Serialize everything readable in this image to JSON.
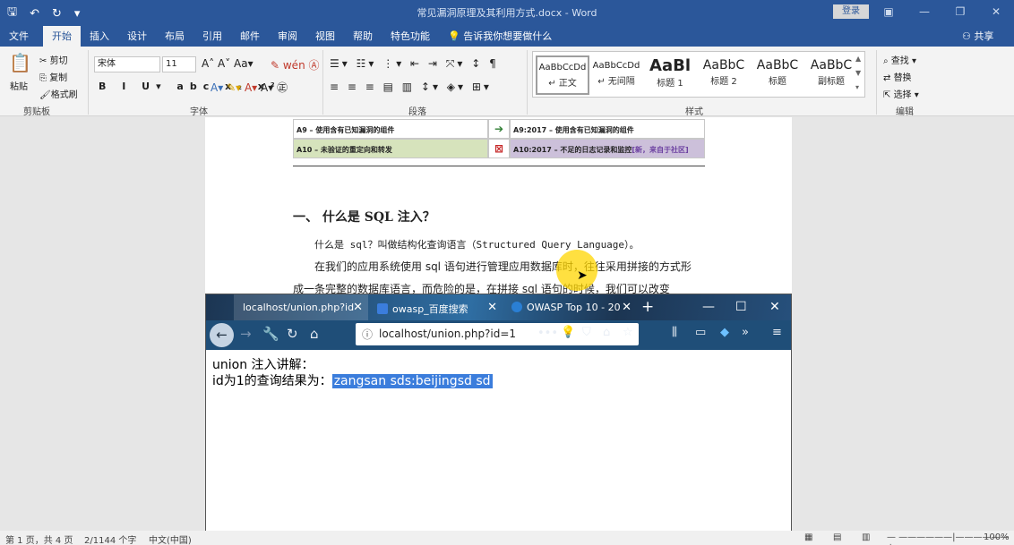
{
  "word": {
    "title": "常见漏洞原理及其利用方式.docx  -  Word",
    "login_button": "登录",
    "tabs": [
      "文件",
      "开始",
      "插入",
      "设计",
      "布局",
      "引用",
      "邮件",
      "审阅",
      "视图",
      "帮助",
      "特色功能"
    ],
    "tell_me": "告诉我你想要做什么",
    "share": "共享",
    "ribbon": {
      "clipboard": {
        "paste": "粘贴",
        "cut": "剪切",
        "copy": "复制",
        "format_painter": "格式刷",
        "label": "剪贴板"
      },
      "font": {
        "name": "宋体",
        "size": "11",
        "label": "字体"
      },
      "paragraph": {
        "label": "段落"
      },
      "styles": {
        "label": "样式",
        "items": [
          {
            "sample": "AaBbCcDd",
            "name": "↵ 正文"
          },
          {
            "sample": "AaBbCcDd",
            "name": "↵ 无间隔"
          },
          {
            "sample": "AaBl",
            "name": "标题 1"
          },
          {
            "sample": "AaBbC",
            "name": "标题 2"
          },
          {
            "sample": "AaBbC",
            "name": "标题"
          },
          {
            "sample": "AaBbC",
            "name": "副标题"
          }
        ]
      },
      "editing": {
        "find": "查找",
        "replace": "替换",
        "select": "选择",
        "label": "编辑"
      }
    },
    "document": {
      "table_rows": [
        {
          "left": "A9 – 使用含有已知漏洞的组件",
          "right": "A9:2017 – 使用含有已知漏洞的组件"
        },
        {
          "left": "A10 – 未验证的重定向和转发",
          "right": "A10:2017 – 不足的日志记录和监控",
          "right_note": "[新，来自于社区]"
        }
      ],
      "heading": "一、   什么是 SQL 注入？",
      "para1": "什么是 sql？叫做结构化查询语言（Structured Query Language）。",
      "para2": "在我们的应用系统使用 sql 语句进行管理应用数据库时，往往采用拼接的方式形",
      "para3": "成一条完整的数据库语言，而危险的是，在拼接 sql 语句的时候，我们可以改变"
    },
    "status": {
      "page": "第 1 页，共 4 页",
      "words": "2/1144 个字",
      "lang": "中文(中国)",
      "zoom": "100%"
    }
  },
  "browser": {
    "tabs": [
      {
        "label": "localhost/union.php?id",
        "active": true
      },
      {
        "label": "owasp_百度搜索",
        "active": false
      },
      {
        "label": "OWASP Top 10 - 20",
        "active": false
      }
    ],
    "url": "localhost/union.php?id=1",
    "content_line1": "union 注入讲解：",
    "content_line2_prefix": "id为1的查询结果为：",
    "content_highlight": "zangsan sds:beijingsd sd"
  },
  "colors": {
    "word_blue": "#2b579a",
    "browser_bar": "#1f4e78",
    "selection": "#3b7ddc"
  }
}
